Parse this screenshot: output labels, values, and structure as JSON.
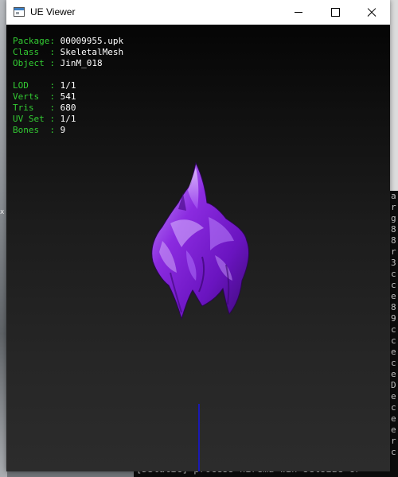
{
  "window": {
    "title": "UE Viewer",
    "icon": "app-window-icon"
  },
  "info_panel": {
    "group1": [
      {
        "label": "Package:",
        "value": "00009955.upk"
      },
      {
        "label": "Class  :",
        "value": "SkeletalMesh"
      },
      {
        "label": "Object :",
        "value": "JinM_018"
      }
    ],
    "group2": [
      {
        "label": "LOD    :",
        "value": "1/1"
      },
      {
        "label": "Verts  :",
        "value": "541"
      },
      {
        "label": "Tris   :",
        "value": "680"
      },
      {
        "label": "UV Set :",
        "value": "1/1"
      },
      {
        "label": "Bones  :",
        "value": "9"
      }
    ],
    "label_color": "#33cc33",
    "value_color": "#ffffff"
  },
  "model": {
    "description_icon": "purple-hair-mesh",
    "color": "#8a2be2"
  },
  "background_console": {
    "bottom_line": "[DStatic] process  hirema win setsize  cr",
    "right_chars": [
      "a",
      "r",
      "g",
      "8",
      "8",
      "r",
      "3",
      "c",
      "c",
      "e",
      "8",
      "9",
      "c",
      "c",
      "e",
      "c",
      "e",
      "D",
      "e",
      "c",
      "e",
      "e",
      "r",
      "c"
    ]
  },
  "desktop": {
    "left_marker": "x"
  }
}
